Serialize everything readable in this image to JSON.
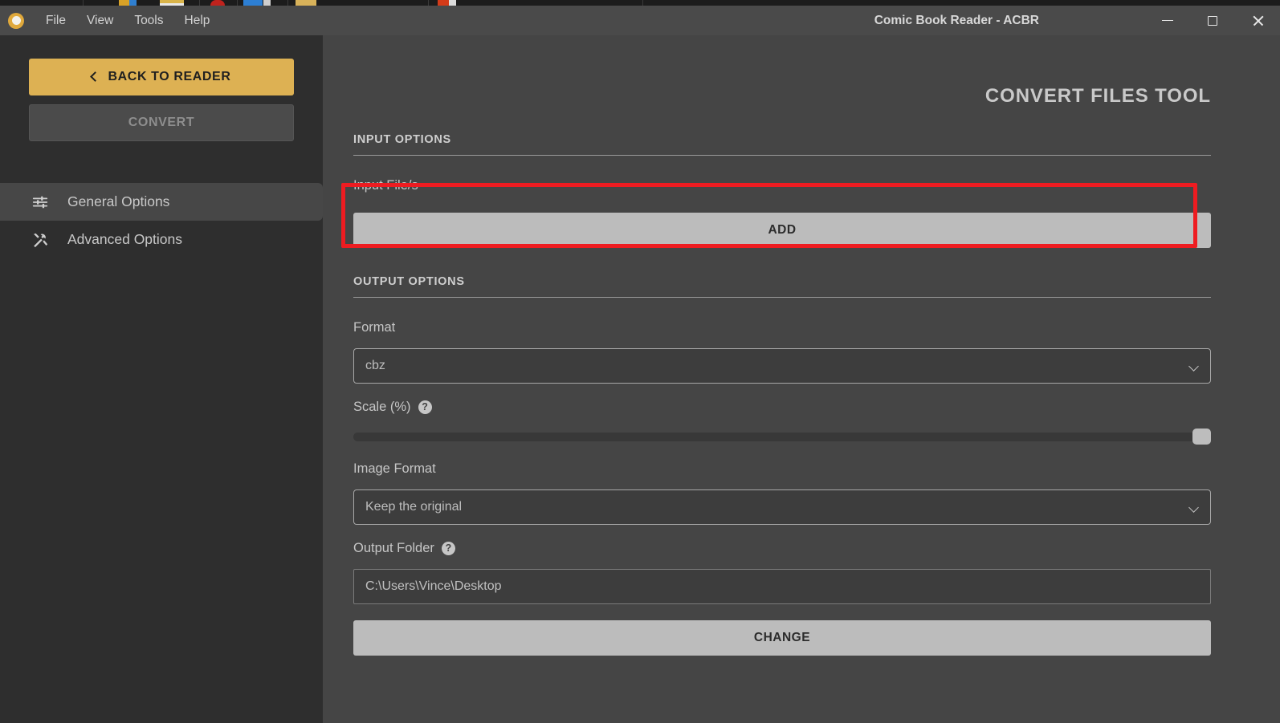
{
  "window": {
    "title": "Comic Book Reader - ACBR",
    "logo_icon": "acbr-circle-logo",
    "controls": [
      {
        "name": "minimize-button",
        "icon": "minimize-icon"
      },
      {
        "name": "maximize-button",
        "icon": "maximize-icon"
      },
      {
        "name": "close-button",
        "icon": "close-icon"
      }
    ]
  },
  "menubar": {
    "items": [
      {
        "label": "File"
      },
      {
        "label": "View"
      },
      {
        "label": "Tools"
      },
      {
        "label": "Help"
      }
    ]
  },
  "sidebar": {
    "back_button": {
      "label": "BACK TO READER",
      "icon": "chevron-left-icon"
    },
    "convert_button": {
      "label": "CONVERT",
      "disabled": true
    },
    "nav_items": [
      {
        "label": "General Options",
        "icon": "tune-sliders-icon",
        "active": true
      },
      {
        "label": "Advanced Options",
        "icon": "hammer-wrench-icon",
        "active": false
      }
    ]
  },
  "main": {
    "tool_title": "CONVERT FILES TOOL",
    "input_section": {
      "header": "INPUT OPTIONS",
      "input_files_label": "Input File/s",
      "add_button_label": "ADD"
    },
    "output_section": {
      "header": "OUTPUT OPTIONS",
      "format_label": "Format",
      "format_value": "cbz",
      "format_chevron_icon": "chevron-down-icon",
      "scale_label": "Scale (%)",
      "scale_help_icon": "help-circle-icon",
      "scale_value": 100,
      "scale_min": 0,
      "scale_max": 100,
      "image_format_label": "Image Format",
      "image_format_value": "Keep the original",
      "image_format_chevron_icon": "chevron-down-icon",
      "output_folder_label": "Output Folder",
      "output_folder_help_icon": "help-circle-icon",
      "output_folder_value": "C:\\Users\\Vince\\Desktop",
      "change_button_label": "CHANGE"
    }
  },
  "annotation": {
    "name": "add-button-highlight",
    "color": "#ee1c21"
  },
  "colors": {
    "accent": "#ddb153",
    "window_chrome": "#4a4a4a",
    "sidebar_bg": "#2e2e2e",
    "main_bg": "#454545",
    "button_light": "#bcbcbc",
    "annotation_red": "#ee1c21"
  }
}
